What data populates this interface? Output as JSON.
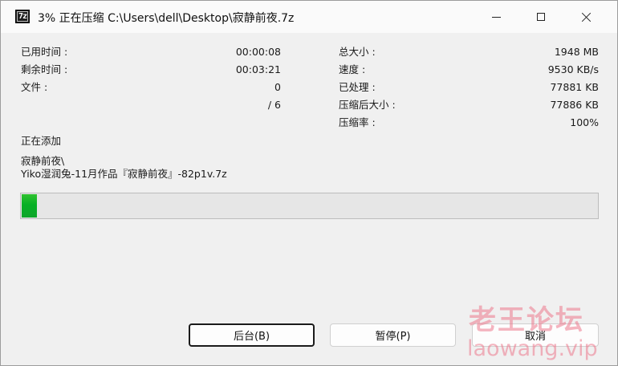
{
  "window": {
    "title": "3% 正在压缩 C:\\Users\\dell\\Desktop\\寂静前夜.7z",
    "icon_text": "7z",
    "icon": "7zip-icon",
    "controls": {
      "minimize_icon": "minimize-icon",
      "maximize_icon": "maximize-icon",
      "close_icon": "close-icon"
    }
  },
  "stats_left": [
    {
      "label": "已用时间 :",
      "value": "00:00:08"
    },
    {
      "label": "剩余时间 :",
      "value": "00:03:21"
    },
    {
      "label": "文件 :",
      "value": "0"
    },
    {
      "label": "",
      "value": "/ 6"
    }
  ],
  "stats_right": [
    {
      "label": "总大小 :",
      "value": "1948 MB"
    },
    {
      "label": "速度 :",
      "value": "9530 KB/s"
    },
    {
      "label": "已处理 :",
      "value": "77881 KB"
    },
    {
      "label": "压缩后大小 :",
      "value": "77886 KB"
    },
    {
      "label": "压缩率 :",
      "value": "100%"
    }
  ],
  "status": {
    "heading": "正在添加",
    "folder": "寂静前夜\\",
    "file": "Yiko湿润兔-11月作品『寂静前夜』-82p1v.7z"
  },
  "progress": {
    "percent": 3,
    "color": "#06b025"
  },
  "buttons": {
    "background": "后台(B)",
    "pause": "暂停(P)",
    "cancel": "取消"
  },
  "watermark": {
    "cn": "老王论坛",
    "en": "laowang.vip",
    "color": "#ec788c"
  }
}
